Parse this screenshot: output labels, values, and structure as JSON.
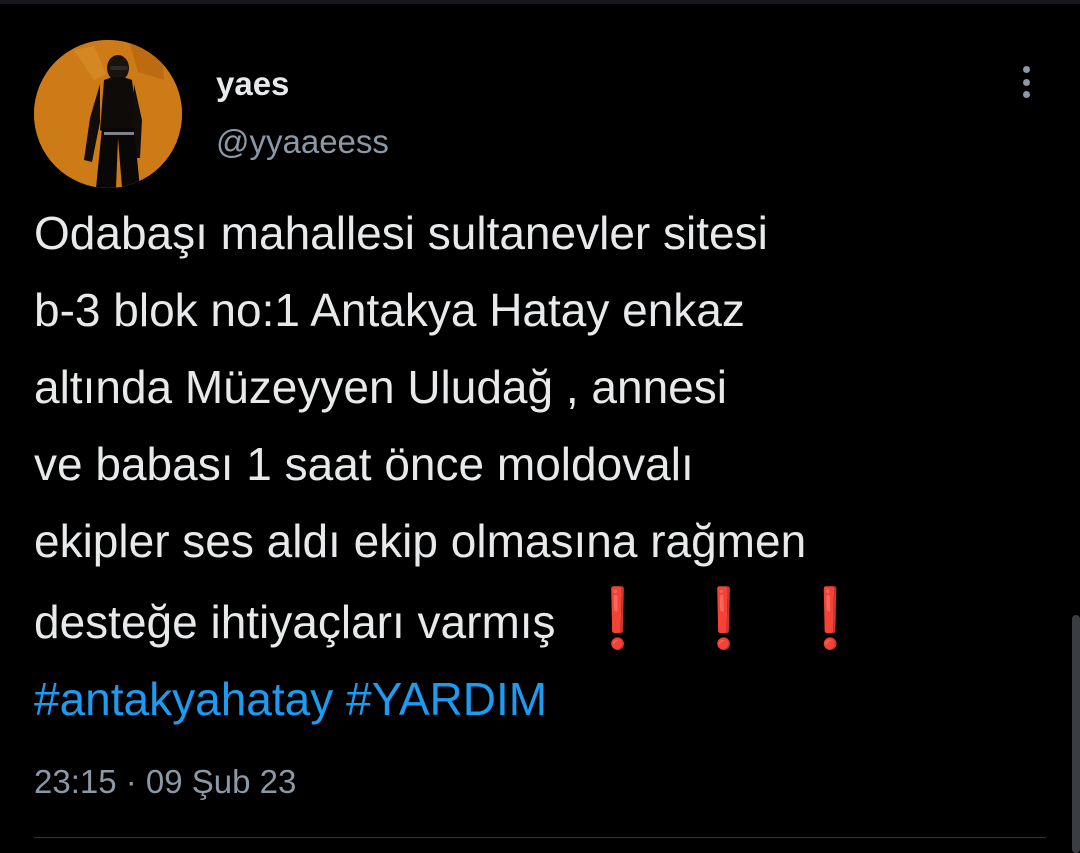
{
  "tweet": {
    "author": {
      "display_name": "yaes",
      "handle": "@yyaaeess"
    },
    "text_lines": [
      "Odabaşı mahallesi sultanevler sitesi",
      "b-3 blok no:1 Antakya Hatay enkaz",
      "altında Müzeyyen Uludağ , annesi",
      "ve babası 1 saat önce moldovalı",
      "ekipler ses aldı ekip olmasına rağmen",
      "desteğe ihtiyaçları varmış"
    ],
    "emoji": [
      "❗",
      "❗",
      "❗"
    ],
    "hashtags": [
      "#antakyahatay",
      "#YARDIM"
    ],
    "timestamp": "23:15 · 09 Şub 23"
  },
  "icons": {
    "more": "more-vertical-icon",
    "emoji": "red-exclamation-icon"
  },
  "colors": {
    "background": "#000000",
    "text": "#e7e9ea",
    "muted": "#8b98a5",
    "hashtag": "#1d9bf0",
    "exclamation": "#e0243a",
    "avatar_background": "#c47415"
  }
}
